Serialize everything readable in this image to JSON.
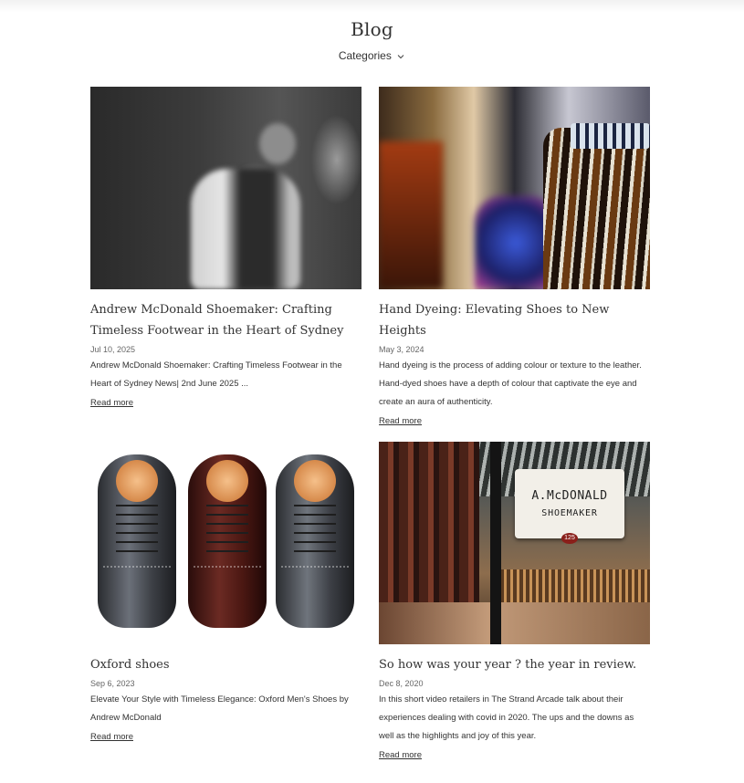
{
  "header": {
    "title": "Blog",
    "categories_label": "Categories"
  },
  "posts": [
    {
      "image": "Workshop craftsman (black and white)",
      "title": "Andrew McDonald Shoemaker: Crafting Timeless Footwear in the Heart of Sydney",
      "date": "Jul 10, 2025",
      "excerpt": "Andrew McDonald Shoemaker: Crafting Timeless Footwear in the Heart of Sydney News| 2nd June 2025 ...",
      "read_more": "Read more"
    },
    {
      "image": "Hand dyeing bottles",
      "title": "Hand Dyeing: Elevating Shoes to New Heights",
      "date": "May 3, 2024",
      "excerpt": "Hand dyeing is the process of adding colour or texture to the leather. Hand-dyed shoes have a depth of colour that captivate the eye and create an aura of authenticity.",
      "read_more": "Read more"
    },
    {
      "image": "Three Oxford shoes",
      "title": "Oxford shoes",
      "date": "Sep 6, 2023",
      "excerpt": "Elevate Your Style with Timeless Elegance: Oxford Men's Shoes by Andrew McDonald",
      "read_more": "Read more"
    },
    {
      "image": "Arcade shop sign",
      "title": "So how was your year ? the year in review.",
      "date": "Dec 8, 2020",
      "excerpt": "In this short video retailers in The Strand Arcade talk about their experiences dealing with covid in 2020. The ups and the downs as well as the highlights and joy of this year.",
      "read_more": "Read more",
      "sign": {
        "line1": "A.McDONALD",
        "line2": "SHOEMAKER",
        "number": "125"
      }
    }
  ]
}
